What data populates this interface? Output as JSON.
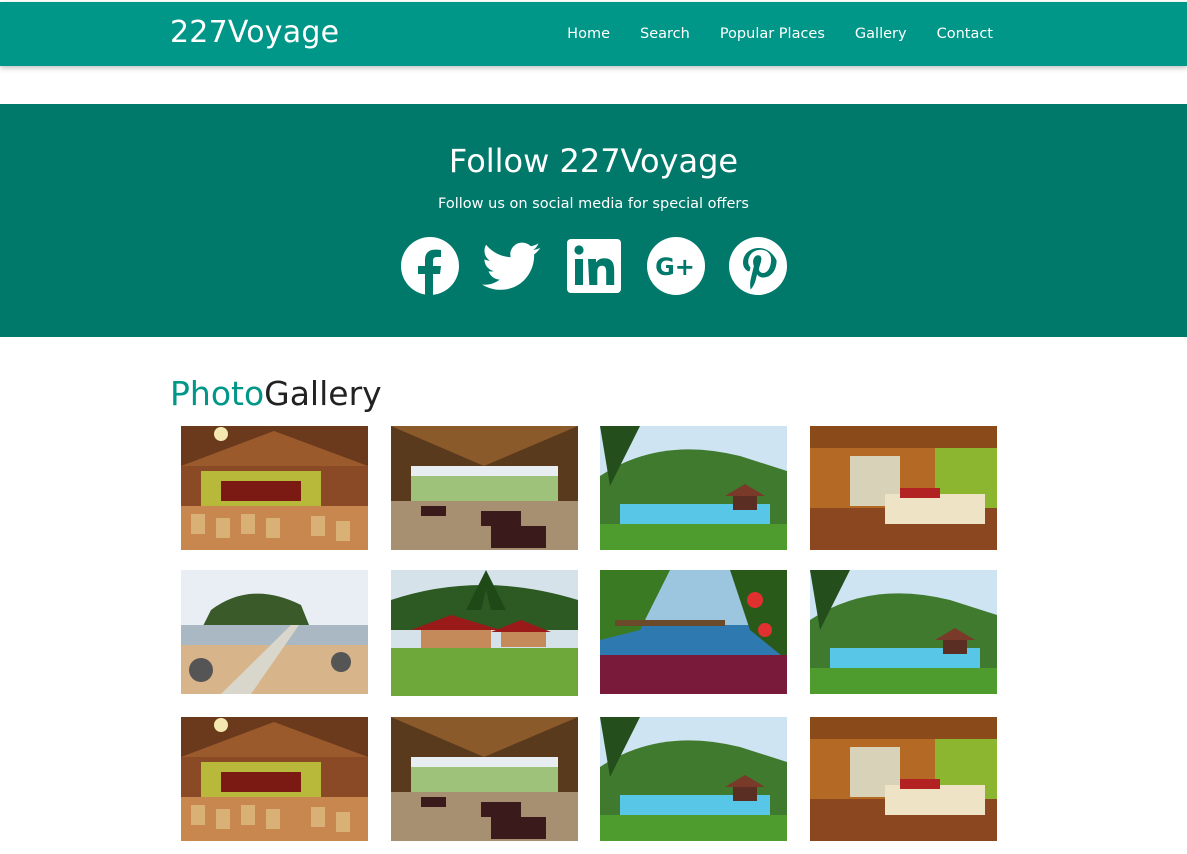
{
  "brand": "227Voyage",
  "nav": [
    "Home",
    "Search",
    "Popular Places",
    "Gallery",
    "Contact"
  ],
  "follow": {
    "title": "Follow 227Voyage",
    "subtitle": "Follow us on social media for special offers",
    "icons": [
      "facebook-icon",
      "twitter-icon",
      "linkedin-icon",
      "google-plus-icon",
      "pinterest-icon"
    ]
  },
  "gallery": {
    "title_accent": "Photo",
    "title_rest": "Gallery",
    "photos": [
      "bar-interior",
      "open-dining-hall",
      "resort-pool-gazebo",
      "hotel-bedroom",
      "beach-boardwalk",
      "red-roof-bungalows",
      "balcony-dining-table",
      "resort-pool-gazebo",
      "bar-interior",
      "open-dining-hall",
      "resort-pool-gazebo",
      "hotel-bedroom"
    ]
  },
  "colors": {
    "navbar": "#009688",
    "follow_band": "#00796b",
    "accent": "#009688"
  }
}
